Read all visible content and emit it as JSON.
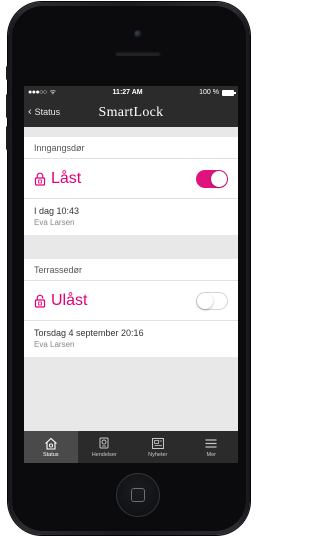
{
  "status_bar": {
    "signal": "●●●○○",
    "wifi": "ᯤ",
    "time": "11:27 AM",
    "battery": "100 %"
  },
  "nav": {
    "back_label": "Status",
    "title": "SmartLock"
  },
  "locks": [
    {
      "name": "Inngangsdør",
      "state": "Låst",
      "toggle_on": true,
      "date": "I dag 10:43",
      "user": "Eva Larsen"
    },
    {
      "name": "Terrassedør",
      "state": "Ulåst",
      "toggle_on": false,
      "date": "Torsdag 4 september 20:16",
      "user": "Eva Larsen"
    }
  ],
  "tabs": [
    {
      "label": "Status",
      "icon": "home-icon",
      "active": true
    },
    {
      "label": "Hendelser",
      "icon": "events-icon",
      "active": false
    },
    {
      "label": "Nyheter",
      "icon": "news-icon",
      "active": false
    },
    {
      "label": "Mer",
      "icon": "menu-icon",
      "active": false
    }
  ],
  "colors": {
    "accent": "#e0137e",
    "bar": "#2b2b2b"
  }
}
